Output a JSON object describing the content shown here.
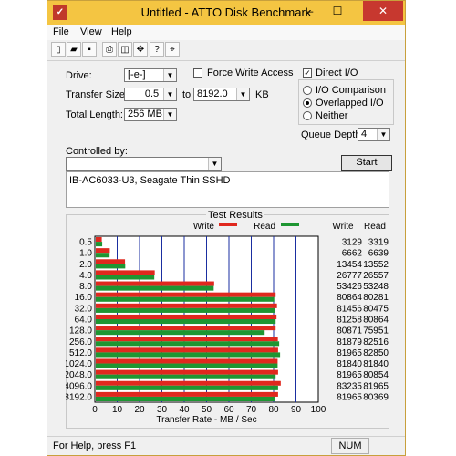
{
  "window": {
    "title": "Untitled - ATTO Disk Benchmark",
    "controls": {
      "minimize": "–",
      "maximize": "☐",
      "close": "✕"
    }
  },
  "menu": [
    "File",
    "View",
    "Help"
  ],
  "toolbar": [
    "new-icon",
    "open-icon",
    "save-icon",
    "print-icon",
    "preview-icon",
    "move-icon",
    "help-icon",
    "context-help-icon"
  ],
  "form": {
    "drive_label": "Drive:",
    "drive_value": "[-e-]",
    "transfer_size_label": "Transfer Size:",
    "transfer_from": "0.5",
    "to_label": "to",
    "transfer_to": "8192.0",
    "kb_label": "KB",
    "total_length_label": "Total Length:",
    "total_length_value": "256 MB",
    "force_write_label": "Force Write Access",
    "force_write_checked": false,
    "direct_io_label": "Direct I/O",
    "direct_io_checked": true,
    "io_comparison_label": "I/O Comparison",
    "overlapped_label": "Overlapped I/O",
    "neither_label": "Neither",
    "selected_mode": "Overlapped I/O",
    "queue_depth_label": "Queue Depth:",
    "queue_depth_value": "4",
    "controlled_by_label": "Controlled by:",
    "controlled_by_value": "",
    "start_label": "Start",
    "description": "IB-AC6033-U3, Seagate Thin SSHD"
  },
  "results": {
    "group_title": "Test Results",
    "write_col": "Write",
    "read_col": "Read",
    "rows": [
      {
        "size": "0.5",
        "write": "3129",
        "read": "3319"
      },
      {
        "size": "1.0",
        "write": "6662",
        "read": "6639"
      },
      {
        "size": "2.0",
        "write": "13454",
        "read": "13552"
      },
      {
        "size": "4.0",
        "write": "26777",
        "read": "26557"
      },
      {
        "size": "8.0",
        "write": "53426",
        "read": "53248"
      },
      {
        "size": "16.0",
        "write": "80864",
        "read": "80281"
      },
      {
        "size": "32.0",
        "write": "81456",
        "read": "80475"
      },
      {
        "size": "64.0",
        "write": "81258",
        "read": "80864"
      },
      {
        "size": "128.0",
        "write": "80871",
        "read": "75951"
      },
      {
        "size": "256.0",
        "write": "81879",
        "read": "82516"
      },
      {
        "size": "512.0",
        "write": "81965",
        "read": "82850"
      },
      {
        "size": "1024.0",
        "write": "81840",
        "read": "81840"
      },
      {
        "size": "2048.0",
        "write": "81965",
        "read": "80854"
      },
      {
        "size": "4096.0",
        "write": "83235",
        "read": "81965"
      },
      {
        "size": "8192.0",
        "write": "81965",
        "read": "80369"
      }
    ]
  },
  "chart_data": {
    "type": "bar",
    "orientation": "horizontal",
    "categories": [
      "0.5",
      "1.0",
      "2.0",
      "4.0",
      "8.0",
      "16.0",
      "32.0",
      "64.0",
      "128.0",
      "256.0",
      "512.0",
      "1024.0",
      "2048.0",
      "4096.0",
      "8192.0"
    ],
    "series": [
      {
        "name": "Write",
        "color": "#e0281e",
        "values": [
          3.1,
          6.7,
          13.5,
          26.8,
          53.4,
          80.9,
          81.5,
          81.3,
          80.9,
          81.9,
          82.0,
          81.8,
          82.0,
          83.2,
          82.0
        ]
      },
      {
        "name": "Read",
        "color": "#1e9632",
        "values": [
          3.3,
          6.6,
          13.6,
          26.6,
          53.2,
          80.3,
          80.5,
          80.9,
          76.0,
          82.5,
          82.9,
          81.8,
          80.9,
          82.0,
          80.4
        ]
      }
    ],
    "xlabel": "Transfer Rate - MB / Sec",
    "xticks": [
      "0",
      "10",
      "20",
      "30",
      "40",
      "50",
      "60",
      "70",
      "80",
      "90",
      "100"
    ],
    "xlim": [
      0,
      100
    ],
    "grid": true
  },
  "status": {
    "help_text": "For Help, press F1",
    "num": "NUM"
  }
}
